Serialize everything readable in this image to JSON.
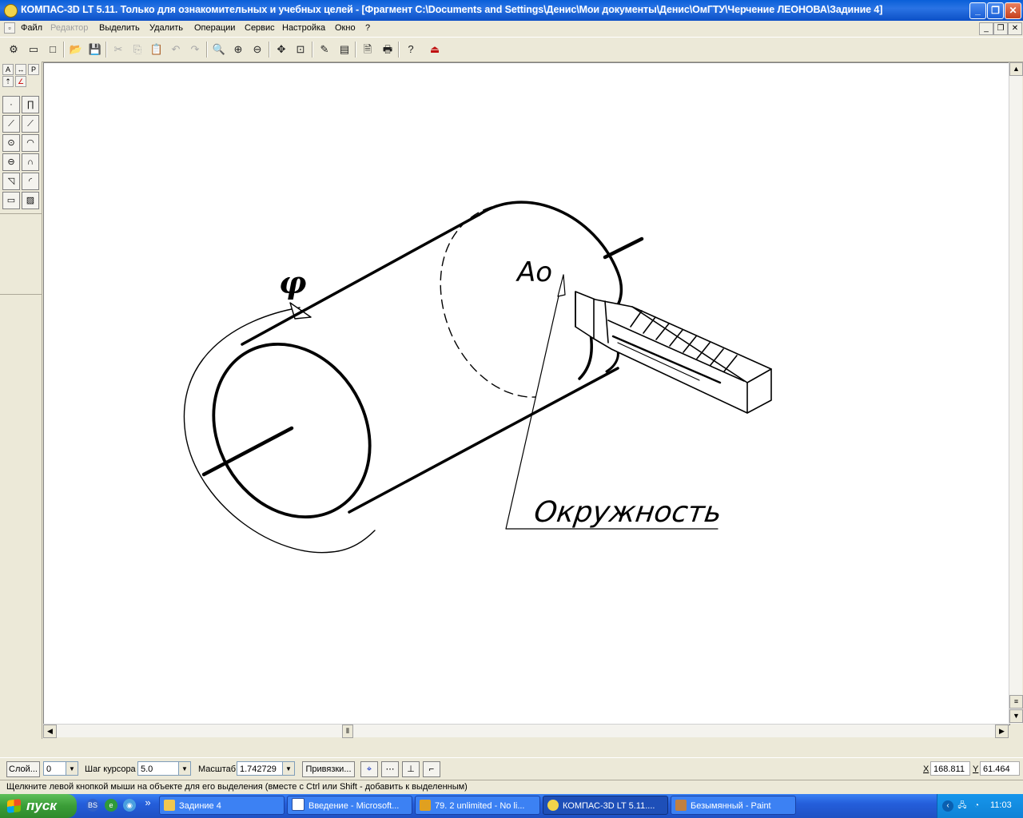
{
  "window": {
    "title": "КОМПАС-3D LT 5.11. Только для ознакомительных и учебных целей - [Фрагмент C:\\Documents and Settings\\Денис\\Мои документы\\Денис\\ОмГТУ\\Черчение ЛЕОНОВА\\Задиние 4]"
  },
  "menu": {
    "items": [
      "Файл",
      "Редактор",
      "Выделить",
      "Удалить",
      "Операции",
      "Сервис",
      "Настройка",
      "Окно",
      "?"
    ]
  },
  "drawing": {
    "label_phi": "φ",
    "label_a0": "Ao",
    "label_circle": "Окружность"
  },
  "props": {
    "layer_label": "Слой...",
    "layer_value": "0",
    "step_label": "Шаг курсора",
    "step_value": "5.0",
    "scale_label": "Масштаб",
    "scale_value": "1.742729",
    "snap_label": "Привязки...",
    "x_label": "X",
    "x_value": "168.811",
    "y_label": "Y",
    "y_value": "61.464"
  },
  "status": {
    "text": "Щелкните левой кнопкой мыши на объекте для его выделения (вместе с Ctrl или Shift - добавить к выделенным)"
  },
  "taskbar": {
    "start": "пуск",
    "tasks": [
      {
        "label": "Задиние 4"
      },
      {
        "label": "Введение - Microsoft..."
      },
      {
        "label": "79. 2 unlimited - No li..."
      },
      {
        "label": "КОМПАС-3D LT 5.11...."
      },
      {
        "label": "Безымянный - Paint"
      }
    ],
    "clock": "11:03"
  }
}
